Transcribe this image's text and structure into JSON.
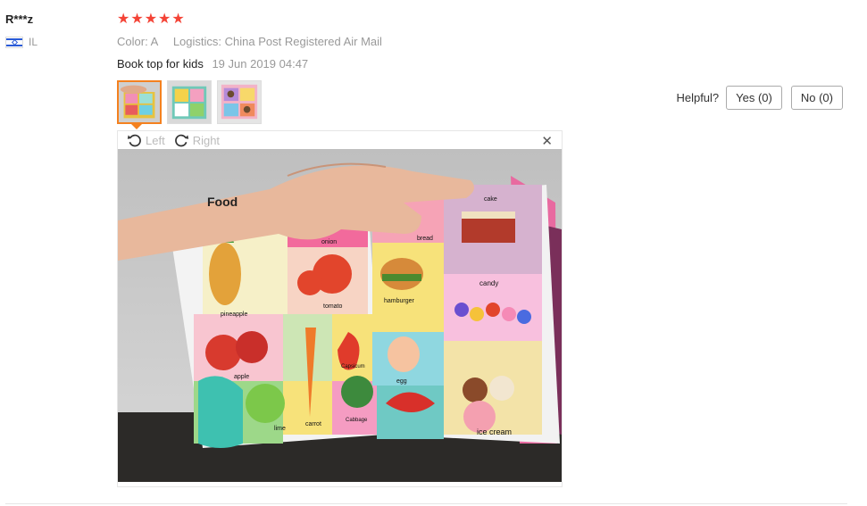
{
  "reviewer": {
    "name": "R***z",
    "country": "IL"
  },
  "rating": {
    "stars": 5,
    "star_color": "#f44336"
  },
  "meta": {
    "color_label": "Color:",
    "color_value": "A",
    "logistics_label": "Logistics:",
    "logistics_value": "China Post Registered Air Mail"
  },
  "review": {
    "text": "Book top for kids",
    "date": "19 Jun 2019 04:47"
  },
  "viewer": {
    "left_label": "Left",
    "right_label": "Right"
  },
  "image_labels": {
    "food": "Food",
    "onion": "onion",
    "pineapple": "pineapple",
    "tomato": "tomato",
    "apple": "apple",
    "capsicum": "Capsicum",
    "lime": "lime",
    "carrot": "carrot",
    "cabbage": "Cabbage",
    "bread": "bread",
    "cake": "cake",
    "hamburger": "hamburger",
    "candy": "candy",
    "egg": "egg",
    "ice_cream": "ice cream"
  },
  "helpful": {
    "label": "Helpful?",
    "yes": "Yes (0)",
    "no": "No (0)"
  },
  "colors": {
    "accent": "#f4811f",
    "muted": "#999999"
  }
}
